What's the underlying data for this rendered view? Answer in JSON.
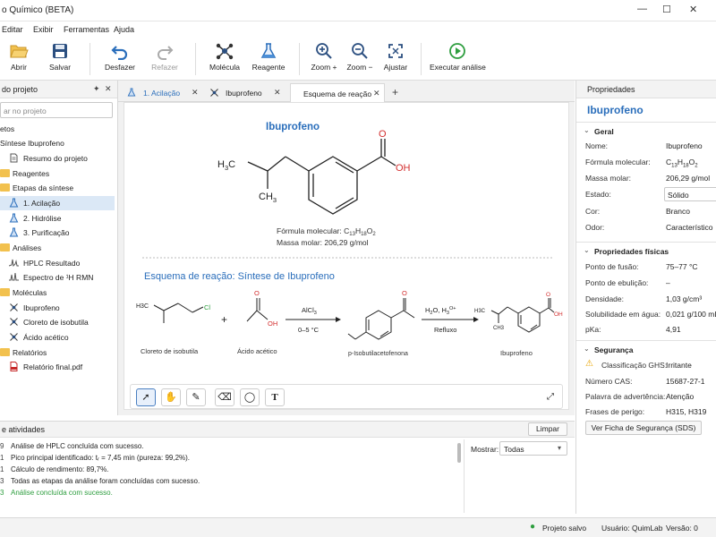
{
  "window": {
    "title": "o Químico (BETA)"
  },
  "menu": [
    "Editar",
    "Exibir",
    "Ferramentas",
    "Ajuda"
  ],
  "toolbar": {
    "open": "Abrir",
    "save": "Salvar",
    "undo": "Desfazer",
    "redo": "Refazer",
    "molecule": "Molécula",
    "reagent": "Reagente",
    "zoom_in": "Zoom +",
    "zoom_out": "Zoom −",
    "fit": "Ajustar",
    "run": "Executar análise"
  },
  "project": {
    "title": "do projeto",
    "search_placeholder": "ar no projeto",
    "tree": [
      {
        "label": "etos"
      },
      {
        "label": "Síntese Ibuprofeno"
      },
      {
        "label": "Resumo do projeto"
      },
      {
        "label": "Reagentes"
      },
      {
        "label": "Etapas da síntese"
      },
      {
        "label": "1. Acilação"
      },
      {
        "label": "2. Hidrólise"
      },
      {
        "label": "3. Purificação"
      },
      {
        "label": "Análises"
      },
      {
        "label": "HPLC Resultado"
      },
      {
        "label": "Espectro de ¹H RMN"
      },
      {
        "label": "Moléculas"
      },
      {
        "label": "Ibuprofeno"
      },
      {
        "label": "Cloreto de isobutila"
      },
      {
        "label": "Ácido acético"
      },
      {
        "label": "Relatórios"
      },
      {
        "label": "Relatório final.pdf"
      }
    ]
  },
  "tabs": [
    "1. Acilação",
    "Ibuprofeno",
    "Esquema de reação"
  ],
  "canvas": {
    "molecule_title": "Ibuprofeno",
    "formula_label": "Fórmula molecular: ",
    "formula_c": "C",
    "formula_c_n": "13",
    "formula_h": "H",
    "formula_h_n": "18",
    "formula_o": "O",
    "formula_o_n": "2",
    "mass_label": "Massa molar: 206,29 g/mol",
    "scheme_title": "Esquema de reação: Síntese de Ibuprofeno",
    "reactant1": "Cloreto de isobutila",
    "reactant2": "Ácido acético",
    "intermediate": "p-Isobutilacetofenona",
    "product": "Ibuprofeno",
    "cond1_top": "AlCl",
    "cond1_top_sub": "3",
    "cond1_bottom": "0–5 °C",
    "cond2_top": "H",
    "cond2_top_mid": "2",
    "cond2_top_rest": "O, H",
    "cond2_top_sub": "3",
    "cond2_top_sup": "O+",
    "cond2_bottom": "Refluxo",
    "plus": "+",
    "atom_h3c": "H",
    "atom_3": "3",
    "atom_c": "C",
    "atom_ch3_c": "CH",
    "atom_o": "O",
    "atom_oh": "OH",
    "atom_cl": "Cl",
    "atom_h3c_small": "H3C",
    "atom_ch3_small": "CH3"
  },
  "properties": {
    "header": "Propriedades",
    "name": "Ibuprofeno",
    "general": "Geral",
    "rows": [
      {
        "k": "Nome:",
        "v": "Ibuprofeno"
      },
      {
        "k": "Fórmula molecular:",
        "v": "C13H18O2"
      },
      {
        "k": "Massa molar:",
        "v": "206,29 g/mol"
      },
      {
        "k": "Estado:",
        "v": "Sólido"
      },
      {
        "k": "Cor:",
        "v": "Branco"
      },
      {
        "k": "Odor:",
        "v": "Característico"
      }
    ],
    "physical": "Propriedades físicas",
    "phys_rows": [
      {
        "k": "Ponto de fusão:",
        "v": "75–77 °C"
      },
      {
        "k": "Ponto de ebulição:",
        "v": "–"
      },
      {
        "k": "Densidade:",
        "v": "1,03 g/cm³"
      },
      {
        "k": "Solubilidade em água:",
        "v": "0,021 g/100 mL ("
      },
      {
        "k": "pKa:",
        "v": "4,91"
      }
    ],
    "safety": "Segurança",
    "safety_rows": [
      {
        "k": "Classificação GHS:",
        "v": "Irritante"
      },
      {
        "k": "Número CAS:",
        "v": "15687-27-1"
      },
      {
        "k": "Palavra de advertência:",
        "v": "Atenção"
      },
      {
        "k": "Frases de perigo:",
        "v": "H315, H319"
      }
    ],
    "sds_button": "Ver Ficha de Segurança (SDS)"
  },
  "activity": {
    "title": "e atividades",
    "clear": "Limpar",
    "show_label": "Mostrar:",
    "filter": "Todas",
    "log": [
      {
        "n": "9",
        "m": "Análise de HPLC concluída com sucesso."
      },
      {
        "n": "1",
        "m": "Pico principal identificado: tᵣ = 7,45 min (pureza: 99,2%)."
      },
      {
        "n": "1",
        "m": "Cálculo de rendimento: 89,7%."
      },
      {
        "n": "3",
        "m": "Todas as etapas da análise foram concluídas com sucesso."
      },
      {
        "n": "3",
        "m": "Análise concluída com sucesso."
      }
    ]
  },
  "status": {
    "saved": "Projeto salvo",
    "user": "Usuário: QuimLab",
    "version": "Versão: 0"
  },
  "colors": {
    "accent": "#2a6ebb",
    "success": "#2e9e3f",
    "oxygen": "#d32f2f",
    "chlorine": "#2e9e3f"
  }
}
